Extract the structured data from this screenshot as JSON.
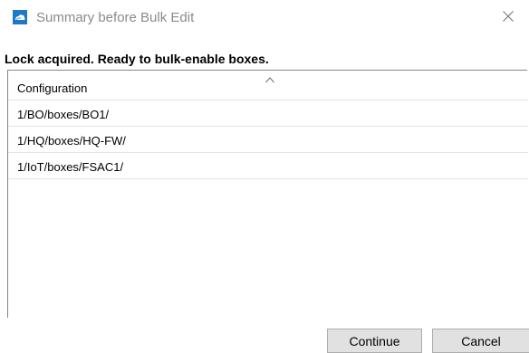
{
  "window": {
    "title": "Summary before Bulk Edit",
    "icon": "app-cloud-icon",
    "close_icon": "close-icon"
  },
  "status": {
    "message": "Lock acquired. Ready to bulk-enable boxes."
  },
  "list": {
    "column_header": "Configuration",
    "sort_indicator": "sort-up-icon",
    "rows": [
      "1/BO/boxes/BO1/",
      "1/HQ/boxes/HQ-FW/",
      "1/IoT/boxes/FSAC1/"
    ]
  },
  "buttons": {
    "continue_label": "Continue",
    "cancel_label": "Cancel"
  },
  "colors": {
    "icon_blue": "#1e78c8",
    "button_face": "#e1e1e1",
    "button_border": "#adadad",
    "title_gray": "#8a8a8a"
  }
}
